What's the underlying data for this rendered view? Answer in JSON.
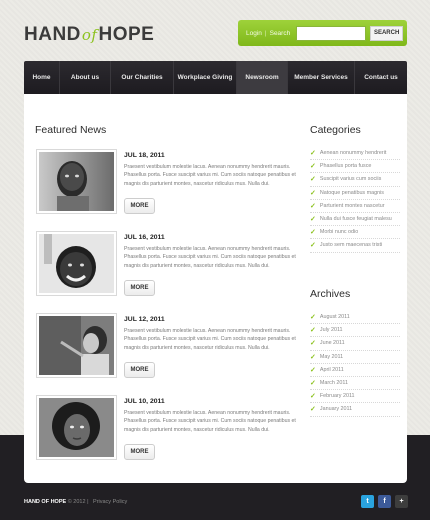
{
  "logo": {
    "text_left": "HAND",
    "text_of": "of",
    "text_right": "HOPE"
  },
  "topbar": {
    "login": "Login",
    "separator": "|",
    "search_link": "Search",
    "search_button": "SEARCH",
    "search_value": ""
  },
  "nav": [
    "Home",
    "About us",
    "Our Charities",
    "Workplace Giving",
    "Newsroom",
    "Member Services",
    "Contact us"
  ],
  "nav_active": "Newsroom",
  "featured": {
    "title": "Featured News",
    "posts": [
      {
        "date": "JUL 18, 2011",
        "excerpt": "Praesent vestibulum molestie lacus. Aenean nonummy hendrerit mauris. Phasellus porta. Fusce suscipit varius mi. Cum sociis natoque penatibus et magnis dis parturient montes, nascetur ridiculus mus. Nulla dui.",
        "button": "MORE"
      },
      {
        "date": "JUL 16, 2011",
        "excerpt": "Praesent vestibulum molestie lacus. Aenean nonummy hendrerit mauris. Phasellus porta. Fusce suscipit varius mi. Cum sociis natoque penatibus et magnis dis parturient montes, nascetur ridiculus mus. Nulla dui.",
        "button": "MORE"
      },
      {
        "date": "JUL 12, 2011",
        "excerpt": "Praesent vestibulum molestie lacus. Aenean nonummy hendrerit mauris. Phasellus porta. Fusce suscipit varius mi. Cum sociis natoque penatibus et magnis dis parturient montes, nascetur ridiculus mus. Nulla dui.",
        "button": "MORE"
      },
      {
        "date": "JUL 10, 2011",
        "excerpt": "Praesent vestibulum molestie lacus. Aenean nonummy hendrerit mauris. Phasellus porta. Fusce suscipit varius mi. Cum sociis natoque penatibus et magnis dis parturient montes, nascetur ridiculus mus. Nulla dui.",
        "button": "MORE"
      }
    ]
  },
  "categories": {
    "title": "Categories",
    "items": [
      "Aenean nonummy hendrerit",
      "Phasellus porta fusce",
      "Suscipit varius cum sociis",
      "Natoque penatibus magnis",
      "Parturient montes nascetur",
      "Nulla dui fusce feugiat malesu",
      "Morbi nunc odio",
      "Justo sem maecenas tristi"
    ]
  },
  "archives": {
    "title": "Archives",
    "items": [
      "August 2011",
      "July 2011",
      "June 2011",
      "May 2011",
      "April 2011",
      "March 2011",
      "February 2011",
      "January 2011"
    ]
  },
  "footer": {
    "brand": "HAND OF HOPE",
    "copyright": "© 2012",
    "separator": "|",
    "privacy": "Privacy Policy"
  },
  "social": [
    {
      "icon": "twitter-icon",
      "glyph": "t",
      "color": "#2aa3df"
    },
    {
      "icon": "facebook-icon",
      "glyph": "f",
      "color": "#3c5a99"
    },
    {
      "icon": "google-plus-icon",
      "glyph": "+",
      "color": "#3d3d3d"
    }
  ],
  "colors": {
    "accent": "#8cc21f",
    "nav": "#211f23"
  }
}
